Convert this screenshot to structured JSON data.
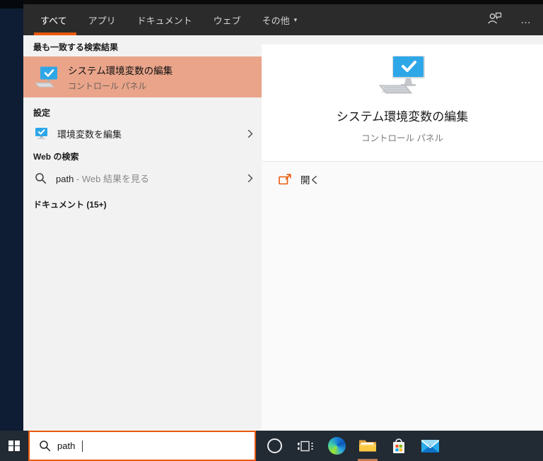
{
  "colors": {
    "accent": "#e8590c",
    "best_match_highlight": "#e9a48a",
    "topbar_bg": "#2b2b2b",
    "taskbar_bg": "#222a33",
    "screen_blue": "#2ea7e8"
  },
  "tabs": {
    "all": "すべて",
    "apps": "アプリ",
    "documents": "ドキュメント",
    "web": "ウェブ",
    "more": "その他",
    "more_caret": "▾",
    "ellipsis": "…"
  },
  "left": {
    "best_match_header": "最も一致する検索結果",
    "best_match": {
      "title": "システム環境変数の編集",
      "subtitle": "コントロール パネル"
    },
    "settings_header": "設定",
    "settings_item": {
      "label": "環境変数を編集"
    },
    "web_header": "Web の検索",
    "web_item": {
      "query": "path",
      "suffix": " - Web 結果を見る"
    },
    "documents_header": "ドキュメント (15+)"
  },
  "right": {
    "title": "システム環境変数の編集",
    "subtitle": "コントロール パネル",
    "open_label": "開く"
  },
  "taskbar": {
    "search_value": "path"
  },
  "icons": {
    "chevron_glyph": "›",
    "check_glyph": "✓"
  }
}
